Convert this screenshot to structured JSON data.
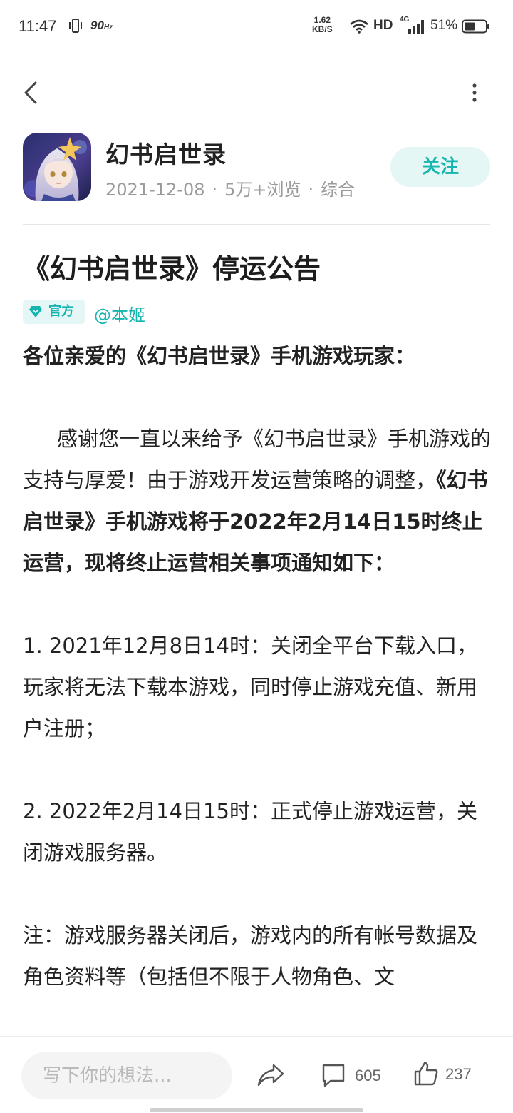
{
  "status_bar": {
    "time": "11:47",
    "refresh_rate": "90",
    "refresh_unit": "Hz",
    "net_speed_value": "1.62",
    "net_speed_unit": "KB/S",
    "hd": "HD",
    "network_type": "4G",
    "battery_percent": "51%",
    "battery_level": 0.51
  },
  "author": {
    "name": "幻书启世录",
    "date": "2021-12-08",
    "views": "5万+浏览",
    "category": "综合",
    "follow_label": "关注"
  },
  "article": {
    "title": "《幻书启世录》停运公告",
    "badge": "官方",
    "mention": "@本姬",
    "greeting": "各位亲爱的《幻书启世录》手机游戏玩家：",
    "para1_normal": "感谢您一直以来给予《幻书启世录》手机游戏的支持与厚爱！由于游戏开发运营策略的调整，",
    "para1_bold": "《幻书启世录》手机游戏将于2022年2月14日15时终止运营，现将终止运营相关事项通知如下：",
    "item1": "1. 2021年12月8日14时：关闭全平台下载入口，玩家将无法下载本游戏，同时停止游戏充值、新用户注册；",
    "item2": "2. 2022年2月14日15时：正式停止游戏运营，关闭游戏服务器。",
    "note": "注：游戏服务器关闭后，游戏内的所有帐号数据及角色资料等（包括但不限于人物角色、文"
  },
  "bottom_bar": {
    "comment_placeholder": "写下你的想法...",
    "comment_count": "605",
    "like_count": "237"
  },
  "colors": {
    "accent": "#16b5b0",
    "accent_bg": "#e4f7f5",
    "meta_gray": "#9a9a9a"
  },
  "icons": {
    "back": "chevron-left-icon",
    "more": "more-vertical-icon",
    "share": "share-arrow-icon",
    "comment": "comment-bubble-icon",
    "like": "thumbs-up-icon",
    "official": "diamond-badge-icon"
  }
}
